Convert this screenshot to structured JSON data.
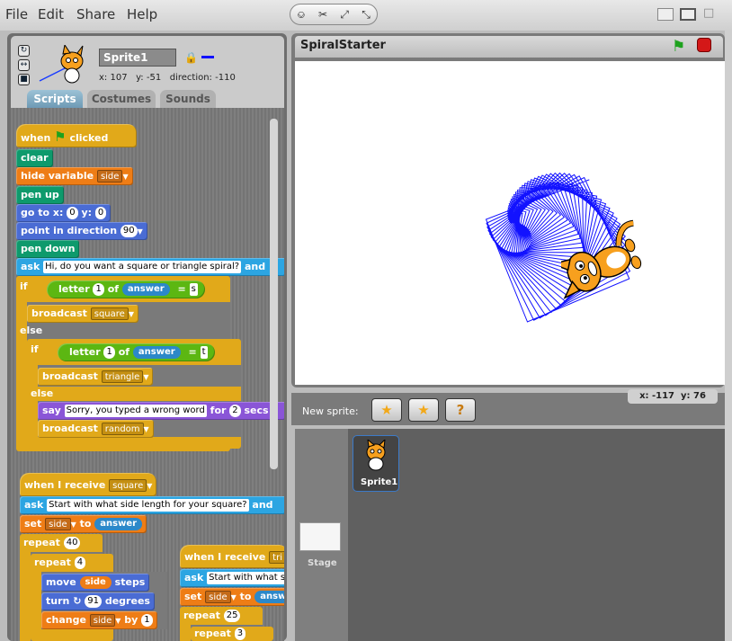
{
  "menu": {
    "file": "File",
    "edit": "Edit",
    "share": "Share",
    "help": "Help"
  },
  "toolbar": {
    "stamp_icon": "stamp-icon",
    "cut_icon": "scissors-icon",
    "grow_icon": "grow-icon",
    "shrink_icon": "shrink-icon"
  },
  "sprite": {
    "name": "Sprite1",
    "x": "x: 107",
    "y": "y: -51",
    "direction": "direction: -110",
    "pen_color": "#1212ff"
  },
  "tabs": {
    "scripts": "Scripts",
    "costumes": "Costumes",
    "sounds": "Sounds"
  },
  "script1": {
    "when": "when",
    "clicked": "clicked",
    "clear": "clear",
    "hide_variable": "hide variable",
    "hide_var_name": "side",
    "pen_up": "pen up",
    "goto": "go to x:",
    "goto_x": "0",
    "goto_y_label": "y:",
    "goto_y": "0",
    "point": "point in direction",
    "point_val": "90",
    "pen_down": "pen down",
    "ask": "ask",
    "ask_text": "Hi, do you want a square or triangle spiral?",
    "ask_and": "and",
    "if1": "if",
    "letter1": "letter",
    "letter1_num": "1",
    "letter1_of": "of",
    "answer1": "answer",
    "eq1": "=",
    "val1": "s",
    "broadcast1": "broadcast",
    "broadcast1_msg": "square",
    "else1": "else",
    "if2": "if",
    "letter2": "letter",
    "letter2_num": "1",
    "letter2_of": "of",
    "answer2": "answer",
    "eq2": "=",
    "val2": "t",
    "broadcast2": "broadcast",
    "broadcast2_msg": "triangle",
    "else2": "else",
    "say": "say",
    "say_text": "Sorry, you typed a wrong word",
    "say_for": "for",
    "say_secs": "2",
    "say_secs_label": "secs",
    "broadcast3": "broadcast",
    "broadcast3_msg": "random"
  },
  "script2": {
    "when_receive": "when I receive",
    "receive_msg": "square",
    "ask": "ask",
    "ask_text": "Start with what side length for your square?",
    "ask_and": "and",
    "set": "set",
    "set_var": "side",
    "set_to": "to",
    "set_val": "answer",
    "repeat": "repeat",
    "repeat_val": "40",
    "repeat2": "repeat",
    "repeat2_val": "4",
    "move": "move",
    "move_var": "side",
    "move_steps": "steps",
    "turn": "turn",
    "turn_val": "91",
    "turn_deg": "degrees",
    "change": "change",
    "change_var": "side",
    "change_by": "by",
    "change_val": "1"
  },
  "script3": {
    "when_receive": "when I receive",
    "receive_msg": "tri",
    "ask": "ask",
    "ask_text": "Start with what s",
    "set": "set",
    "set_var": "side",
    "set_to": "to",
    "set_val": "answ",
    "repeat": "repeat",
    "repeat_val": "25",
    "repeat2": "repeat",
    "repeat2_val": "3"
  },
  "stage": {
    "title": "SpiralStarter",
    "mouse_x": "x: -117",
    "mouse_y": "y: 76"
  },
  "new_sprite": {
    "label": "New sprite:"
  },
  "sprites": {
    "stage_label": "Stage",
    "sprite1_label": "Sprite1"
  }
}
